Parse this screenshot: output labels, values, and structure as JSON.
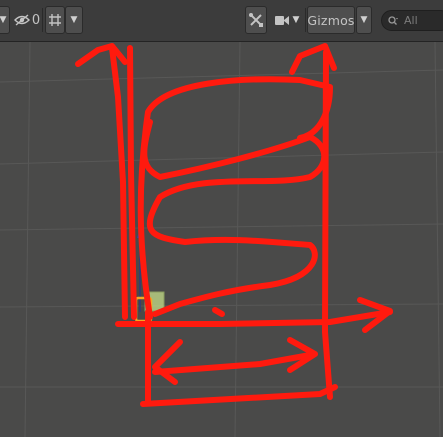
{
  "toolbar": {
    "hidden_count": "0",
    "gizmos_label": "Gizmos",
    "search_placeholder": "All"
  },
  "colors": {
    "toolbar_bg": "#3c3c3c",
    "scene_bg": "#4a4a49",
    "grid": "#5a5a59",
    "annotation": "#ff1a0e",
    "selection_outline": "#f5a623",
    "selected_object": "#c7e08a"
  },
  "icons": [
    "dropdown-arrow-icon",
    "eye-hidden-icon",
    "grid-snap-icon",
    "tools-icon",
    "camera-icon",
    "search-icon"
  ]
}
